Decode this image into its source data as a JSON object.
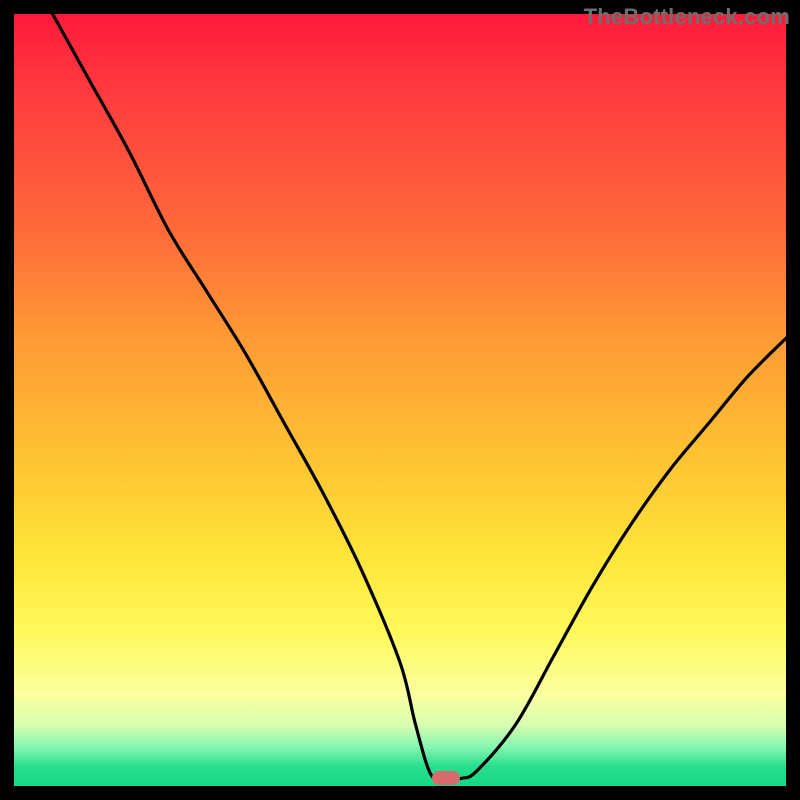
{
  "watermark": "TheBottleneck.com",
  "chart_data": {
    "type": "line",
    "title": "",
    "xlabel": "",
    "ylabel": "",
    "xlim": [
      0,
      100
    ],
    "ylim": [
      0,
      100
    ],
    "grid": false,
    "legend": false,
    "series": [
      {
        "name": "bottleneck-curve",
        "x": [
          5,
          10,
          15,
          20,
          25,
          30,
          35,
          40,
          45,
          50,
          52,
          54,
          56,
          58,
          60,
          65,
          70,
          75,
          80,
          85,
          90,
          95,
          100
        ],
        "y": [
          100,
          91,
          82,
          72,
          64,
          56,
          47,
          38,
          28,
          16,
          8,
          1.5,
          1,
          1,
          2,
          8,
          17,
          26,
          34,
          41,
          47,
          53,
          58
        ]
      }
    ],
    "annotations": [
      {
        "name": "optimal-point-marker",
        "x": 56,
        "y": 1
      }
    ],
    "background_gradient": {
      "top_color": "#ff1a3a",
      "bottom_color": "#17d885",
      "meaning_top": "high-bottleneck",
      "meaning_bottom": "no-bottleneck"
    }
  }
}
